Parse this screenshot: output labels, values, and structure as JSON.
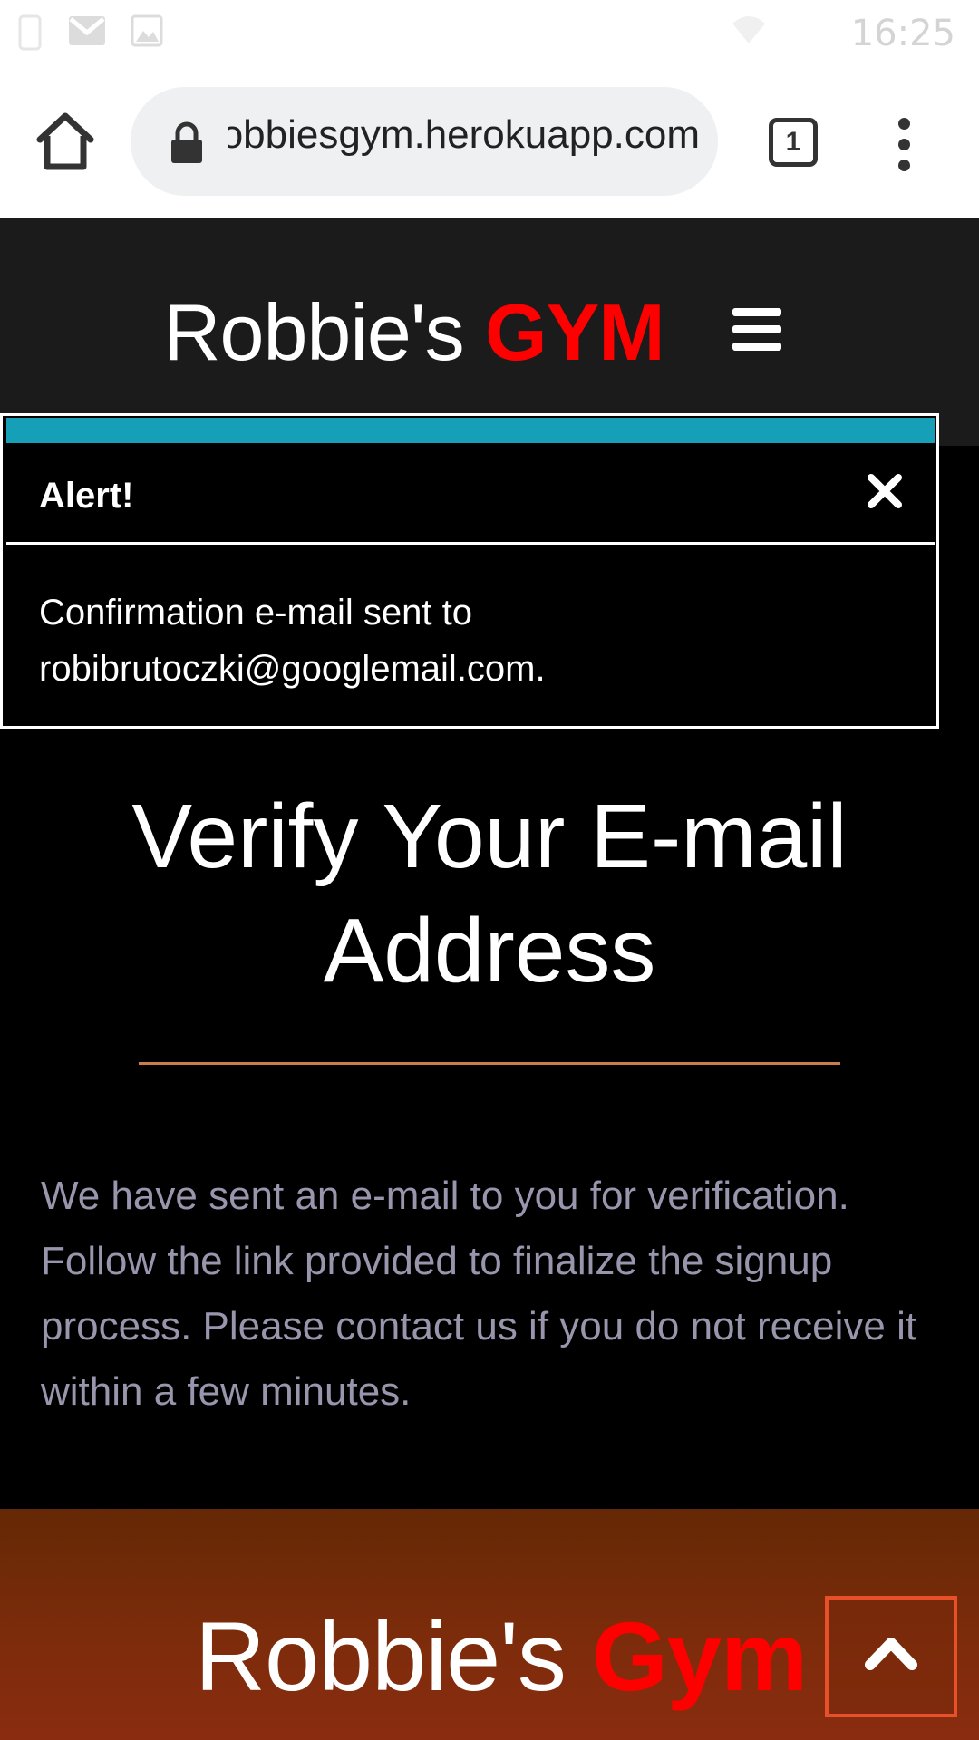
{
  "status_bar": {
    "time": "16:25",
    "icons": [
      "notification-icon",
      "gmail-icon",
      "gallery-icon",
      "wifi-icon"
    ]
  },
  "browser": {
    "url": "robbiesgym.herokuapp.com",
    "tab_count": "1",
    "icons": [
      "home-icon",
      "lock-icon",
      "tab-switcher-icon",
      "more-vert-icon"
    ]
  },
  "header": {
    "brand_prefix": "Robbie's",
    "brand_accent": "GYM",
    "menu_icon": "hamburger-icon"
  },
  "alert": {
    "title": "Alert!",
    "message_line1": "Confirmation e-mail sent to",
    "message_line2": "robibrutoczki@googlemail.com.",
    "close_icon": "close-icon",
    "accent_color": "#16a0b8"
  },
  "main": {
    "title_line1": "Verify Your E-mail",
    "title_line2": "Address",
    "text": "We have sent an e-mail to you for verification. Follow the link provided to finalize the signup process. Please contact us if you do not receive it within a few minutes."
  },
  "footer": {
    "brand_prefix": "Robbie's",
    "brand_accent": "Gym",
    "back_to_top_icon": "chevron-up-icon"
  },
  "colors": {
    "brand_accent": "#ff0000",
    "divider": "#c87d4b",
    "body_text": "#9995ad",
    "footer_button_border": "#e8502a"
  }
}
